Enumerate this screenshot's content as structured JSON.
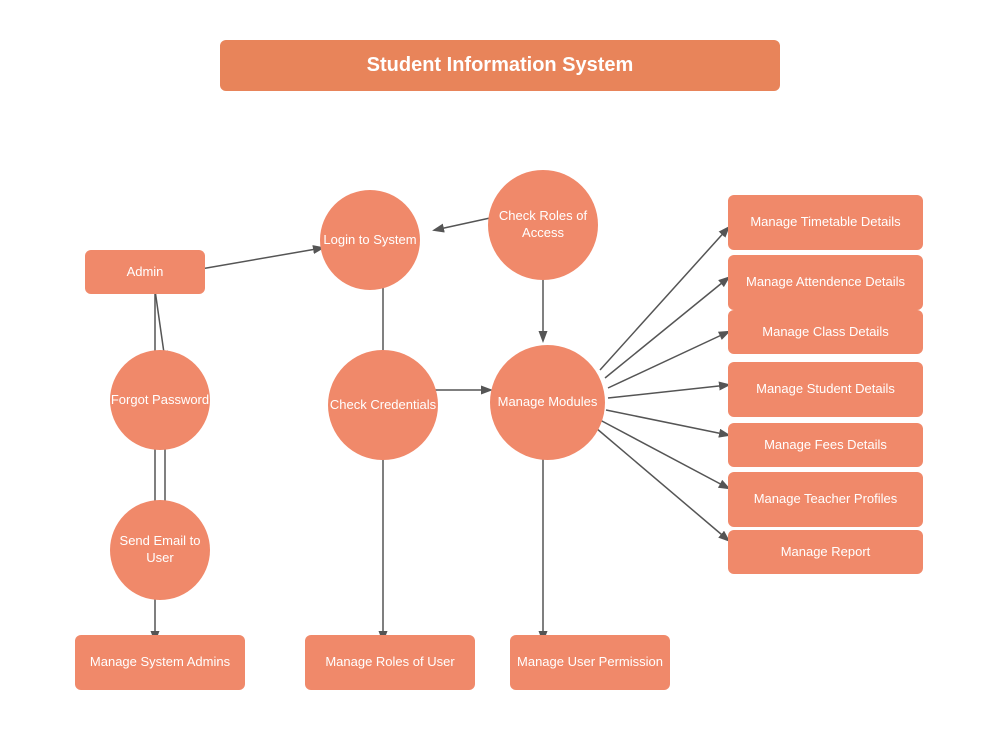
{
  "title": "Student Information System",
  "nodes": {
    "admin": {
      "label": "Admin"
    },
    "login": {
      "label": "Login to\nSystem"
    },
    "checkRoles": {
      "label": "Check\nRoles of\nAccess"
    },
    "forgotPassword": {
      "label": "Forgot\nPassword"
    },
    "checkCredentials": {
      "label": "Check\nCredentials"
    },
    "manageModules": {
      "label": "Manage\nModules"
    },
    "sendEmail": {
      "label": "Send Email\nto User"
    },
    "manageSystemAdmins": {
      "label": "Manage System\nAdmins"
    },
    "manageRolesOfUser": {
      "label": "Manage Roles of User"
    },
    "manageUserPermission": {
      "label": "Manage User\nPermission"
    },
    "manageTimetable": {
      "label": "Manage Timetable\nDetails"
    },
    "manageAttendence": {
      "label": "Manage Attendence\nDetails"
    },
    "manageClassDetails": {
      "label": "Manage Class Details"
    },
    "manageStudentDetails": {
      "label": "Manage Student\nDetails"
    },
    "manageFeesDetails": {
      "label": "Manage Fees Details"
    },
    "manageTeacherProfiles": {
      "label": "Manage Teacher\nProfiles"
    },
    "manageReport": {
      "label": "Manage Report"
    }
  }
}
